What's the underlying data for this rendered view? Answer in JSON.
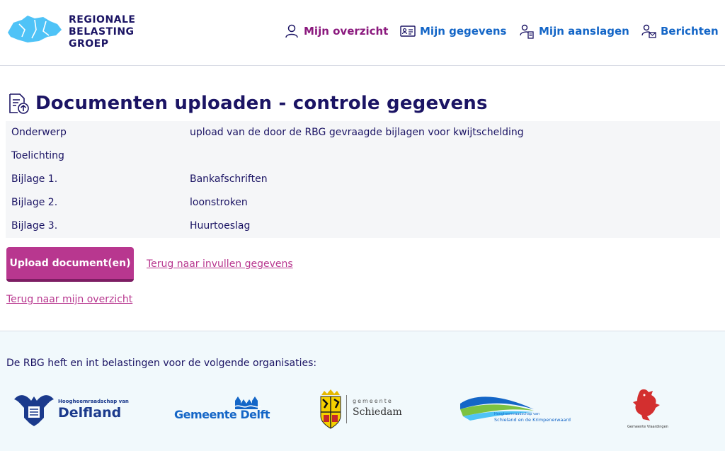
{
  "header": {
    "logo_lines": [
      "REGIONALE",
      "BELASTING",
      "GROEP"
    ],
    "nav": [
      {
        "label": "Mijn overzicht",
        "icon": "person-icon",
        "active": true
      },
      {
        "label": "Mijn gegevens",
        "icon": "id-card-icon",
        "active": false
      },
      {
        "label": "Mijn aanslagen",
        "icon": "person-document-icon",
        "active": false
      },
      {
        "label": "Berichten",
        "icon": "person-mail-icon",
        "active": false
      }
    ]
  },
  "main": {
    "title": "Documenten uploaden - controle gegevens",
    "rows": [
      {
        "key": "Onderwerp",
        "value": "upload van de door de RBG gevraagde bijlagen voor kwijtschelding"
      },
      {
        "key": "Toelichting",
        "value": ""
      },
      {
        "key": "Bijlage 1.",
        "value": "Bankafschriften"
      },
      {
        "key": "Bijlage 2.",
        "value": "loonstroken"
      },
      {
        "key": "Bijlage 3.",
        "value": "Huurtoeslag"
      }
    ],
    "upload_button": "Upload document(en)",
    "back_fill_link": "Terug naar invullen gegevens",
    "back_overview_link": "Terug naar mijn overzicht"
  },
  "footer": {
    "text": "De RBG heft en int belastingen voor de volgende organisaties:",
    "orgs": {
      "delfland_small": "Hoogheemraadschap van",
      "delfland_big": "Delfland",
      "delft": "Gemeente Delft",
      "schiedam_small": "gemeente",
      "schiedam_big": "Schiedam",
      "schieland_line1": "Hoogheemraadschap van",
      "schieland_line2": "Schieland en de Krimpenerwaard",
      "vlaardingen": "Gemeente Vlaardingen"
    }
  },
  "colors": {
    "navy": "#1b1464",
    "accent_purple": "#8b1a7e",
    "link_blue": "#1466c7",
    "button_magenta": "#b8378f",
    "logo_cyan": "#4fc3f7"
  }
}
